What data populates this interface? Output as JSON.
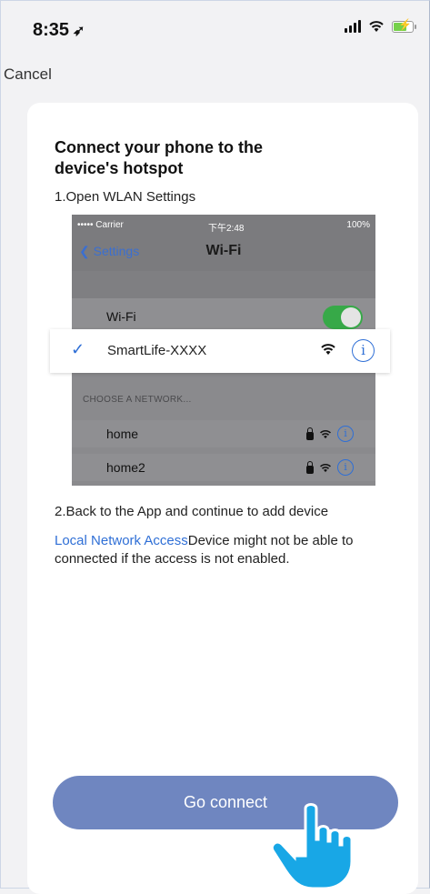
{
  "status_bar": {
    "time": "8:35"
  },
  "nav": {
    "cancel_label": "Cancel"
  },
  "card": {
    "title": "Connect your phone to the device's hotspot",
    "step1": "1.Open WLAN Settings",
    "step2": "2.Back to the App and continue to add device",
    "note_link": "Local Network Access",
    "note_text": "Device might not be able to connected if the access is not enabled.",
    "button_label": "Go connect"
  },
  "embedded_screenshot": {
    "carrier": "••••• Carrier",
    "time": "下午2:48",
    "battery": "100%",
    "back_label": "Settings",
    "title": "Wi-Fi",
    "wifi_label": "Wi-Fi",
    "wifi_enabled": true,
    "highlighted_network": "SmartLife-XXXX",
    "section_header": "CHOOSE A NETWORK...",
    "networks": [
      "home",
      "home2"
    ]
  },
  "colors": {
    "accent": "#2f6fd6",
    "button": "#6f86c0",
    "toggle": "#37a948"
  },
  "icons": [
    "location-arrow-icon",
    "signal-icon",
    "wifi-icon",
    "battery-icon",
    "checkmark-icon",
    "info-icon",
    "lock-icon",
    "hand-pointer-icon"
  ]
}
